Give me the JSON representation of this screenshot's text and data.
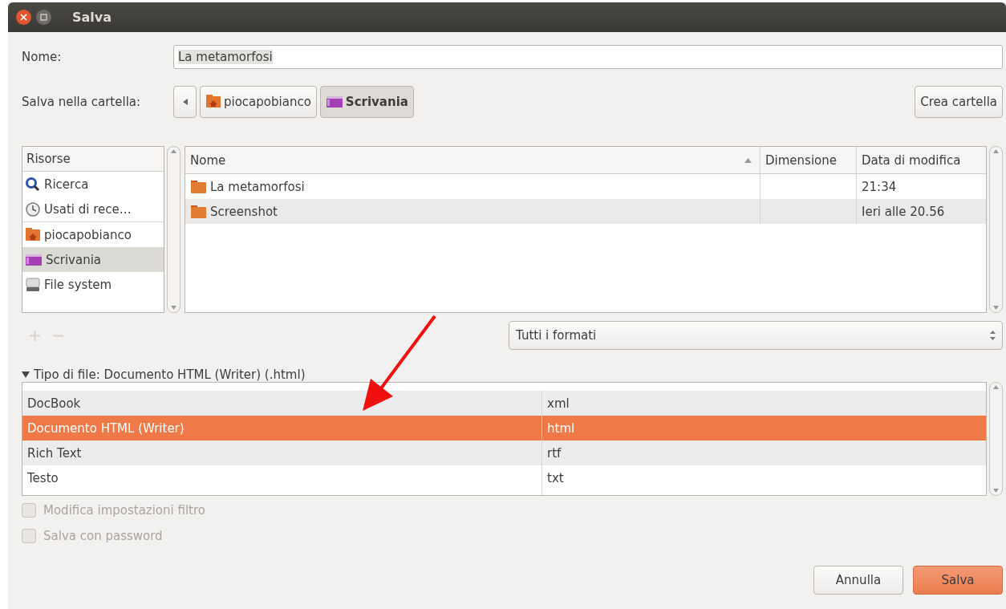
{
  "window": {
    "title": "Salva"
  },
  "name_field": {
    "label": "Nome:",
    "value": "La metamorfosi"
  },
  "folder": {
    "label": "Salva nella cartella:",
    "breadcrumbs": [
      {
        "label": "piocapobianco",
        "kind": "home",
        "selected": false
      },
      {
        "label": "Scrivania",
        "kind": "desktop",
        "selected": true
      }
    ],
    "create_button": "Crea cartella"
  },
  "places": {
    "header": "Risorse",
    "items": [
      {
        "label": "Ricerca",
        "kind": "search",
        "selected": false
      },
      {
        "label": "Usati di rece…",
        "kind": "recent",
        "selected": false
      },
      {
        "label": "piocapobianco",
        "kind": "home",
        "selected": false
      },
      {
        "label": "Scrivania",
        "kind": "desktop",
        "selected": true
      },
      {
        "label": "File system",
        "kind": "drive",
        "selected": false
      }
    ]
  },
  "files": {
    "columns": [
      {
        "label": "Nome",
        "sorted": true
      },
      {
        "label": "Dimensione",
        "sorted": false
      },
      {
        "label": "Data di modifica",
        "sorted": false
      }
    ],
    "rows": [
      {
        "name": "La metamorfosi",
        "modified": "21:34",
        "selected": false
      },
      {
        "name": "Screenshot",
        "modified": "Ieri alle 20.56",
        "selected": true
      }
    ]
  },
  "filter": {
    "value": "Tutti i formati"
  },
  "file_type": {
    "label": "Tipo di file: Documento HTML (Writer) (.html)",
    "expanded": true,
    "rows": [
      {
        "name": "DocBook",
        "ext": "xml",
        "selected": false
      },
      {
        "name": "Documento HTML (Writer)",
        "ext": "html",
        "selected": true
      },
      {
        "name": "Rich Text",
        "ext": "rtf",
        "selected": false
      },
      {
        "name": "Testo",
        "ext": "txt",
        "selected": false
      }
    ]
  },
  "options": [
    {
      "label": "Modifica impostazioni filtro",
      "checked": false,
      "disabled": true
    },
    {
      "label": "Salva con password",
      "checked": false,
      "disabled": true
    }
  ],
  "buttons": [
    {
      "label": "Annulla",
      "kind": "cancel"
    },
    {
      "label": "Salva",
      "kind": "default"
    }
  ]
}
